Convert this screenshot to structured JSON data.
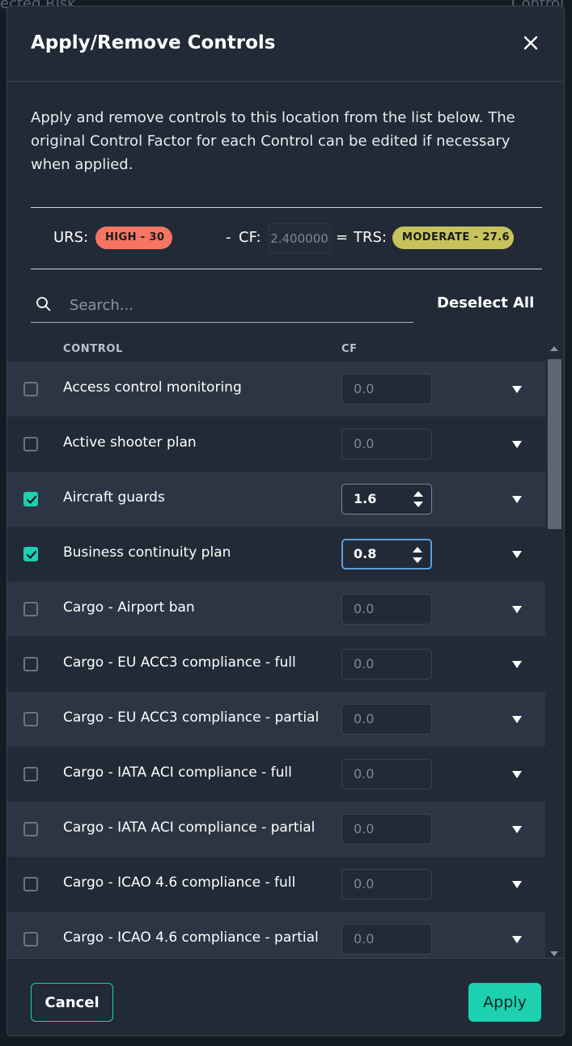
{
  "background": {
    "fragments": [
      "ected Risk",
      "Control"
    ]
  },
  "modal": {
    "title": "Apply/Remove Controls",
    "close_icon": "close-icon",
    "description": "Apply and remove controls to this location from the list below. The original Control Factor for each Control can be edited if necessary when applied."
  },
  "score": {
    "urs_label": "URS:",
    "urs_badge": "HIGH -  30",
    "minus": "-",
    "cf_label": "CF:",
    "cf_value": "2.400000",
    "equals": "=",
    "trs_label": "TRS:",
    "trs_badge": "MODERATE -  27.6",
    "colors": {
      "high": "#f47560",
      "moderate": "#c7c25c"
    }
  },
  "search": {
    "placeholder": "Search...",
    "icon": "search-icon",
    "value": ""
  },
  "deselect_all": "Deselect All",
  "table": {
    "columns": {
      "control": "CONTROL",
      "cf": "CF"
    },
    "rows": [
      {
        "name": "Access control monitoring",
        "cf": "0.0",
        "checked": false
      },
      {
        "name": "Active shooter plan",
        "cf": "0.0",
        "checked": false
      },
      {
        "name": "Aircraft guards",
        "cf": "1.6",
        "checked": true
      },
      {
        "name": "Business continuity plan",
        "cf": "0.8",
        "checked": true,
        "focused": true
      },
      {
        "name": "Cargo - Airport ban",
        "cf": "0.0",
        "checked": false
      },
      {
        "name": "Cargo - EU ACC3 compliance - full",
        "cf": "0.0",
        "checked": false
      },
      {
        "name": "Cargo - EU ACC3 compliance - partial",
        "cf": "0.0",
        "checked": false
      },
      {
        "name": "Cargo - IATA ACI compliance - full",
        "cf": "0.0",
        "checked": false
      },
      {
        "name": "Cargo - IATA ACI compliance - partial",
        "cf": "0.0",
        "checked": false
      },
      {
        "name": "Cargo - ICAO 4.6 compliance - full",
        "cf": "0.0",
        "checked": false
      },
      {
        "name": "Cargo - ICAO 4.6 compliance - partial",
        "cf": "0.0",
        "checked": false
      }
    ]
  },
  "footer": {
    "cancel": "Cancel",
    "apply": "Apply",
    "accent": "#1cd0b0"
  }
}
